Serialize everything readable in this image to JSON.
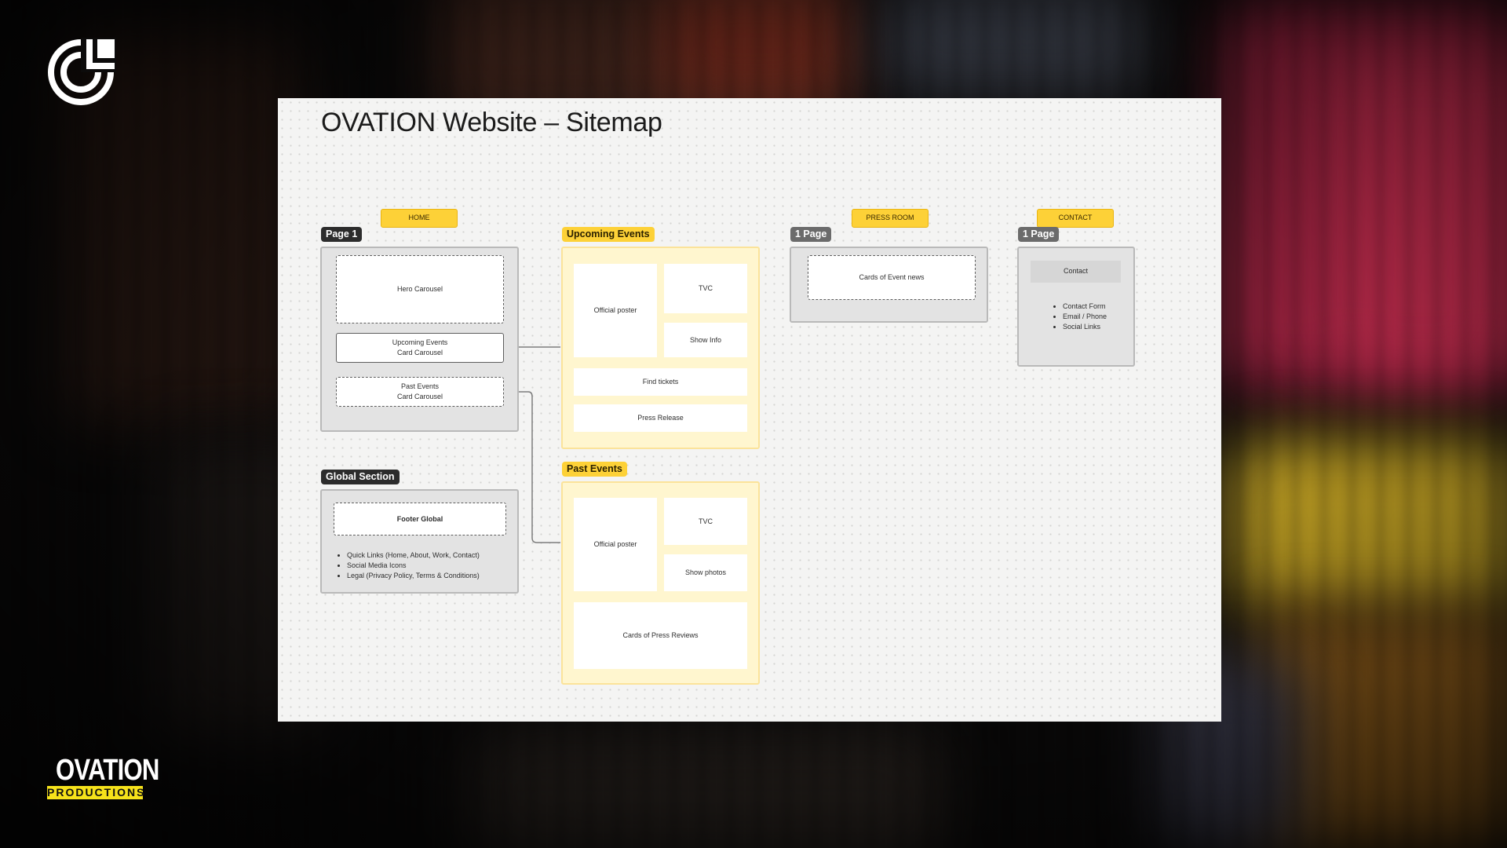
{
  "title": "OVATION Website – Sitemap",
  "brand": {
    "logo_word": "OVATION",
    "logo_sub": "PRODUCTIONS"
  },
  "colors": {
    "accent_yellow": "#fdd137",
    "panel_yellow": "#fff6cf",
    "panel_grey": "#e3e3e3",
    "tag_dark": "#2c2c2c",
    "tag_grey": "#6b6b6b",
    "board": "#f4f4f3"
  },
  "icons": {
    "top_logo": "circular-g-logo-icon"
  },
  "home": {
    "nav": "HOME",
    "tag": "Page 1",
    "cards": {
      "hero": "Hero Carousel",
      "upcoming_line1": "Upcoming Events",
      "upcoming_line2": "Card Carousel",
      "past_line1": "Past Events",
      "past_line2": "Card Carousel"
    }
  },
  "global": {
    "tag": "Global Section",
    "footer": "Footer Global",
    "items": [
      "Quick Links (Home, About, Work, Contact)",
      "Social Media Icons",
      "Legal (Privacy Policy, Terms & Conditions)"
    ]
  },
  "upcoming": {
    "tag": "Upcoming Events",
    "poster": "Official poster",
    "tvc": "TVC",
    "show_info": "Show Info",
    "tickets": "Find tickets",
    "press": "Press Release"
  },
  "past": {
    "tag": "Past Events",
    "poster": "Official poster",
    "tvc": "TVC",
    "photos": "Show photos",
    "reviews": "Cards of Press Reviews"
  },
  "press_room": {
    "nav": "PRESS ROOM",
    "tag": "1 Page",
    "card": "Cards of Event news"
  },
  "contact": {
    "nav": "CONTACT",
    "tag": "1 Page",
    "box": "Contact",
    "items": [
      "Contact Form",
      "Email / Phone",
      "Social Links"
    ]
  }
}
